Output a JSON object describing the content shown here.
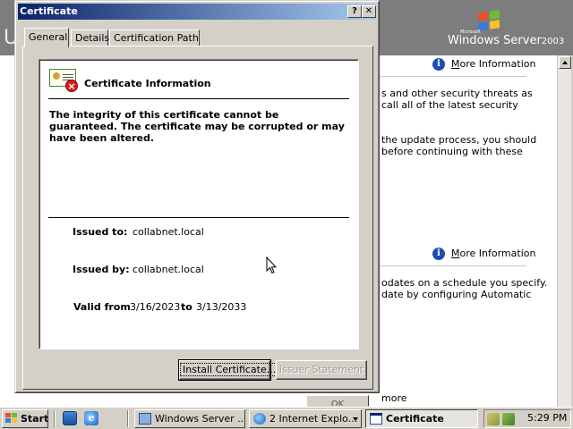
{
  "background": {
    "banner_letter": "U",
    "logo": {
      "small": "Microsoft",
      "product": "Windows Server",
      "year": "2003"
    },
    "more_info_1": "More Information",
    "more_info_2": "More Information",
    "text_lines_1": [
      "s and other security threats as",
      "call all of the latest security"
    ],
    "text_lines_2": [
      "the update process, you should",
      "before continuing with these"
    ],
    "text_lines_3": [
      "odates on a schedule you specify.",
      "date by configuring Automatic"
    ],
    "more_link": "more",
    "ok_partial": "OK"
  },
  "dialog": {
    "title": "Certificate",
    "help_btn": "?",
    "close_btn": "✕",
    "tabs": [
      "General",
      "Details",
      "Certification Path"
    ],
    "heading": "Certificate Information",
    "warning": "The integrity of this certificate cannot be guaranteed. The certificate may be corrupted or may have been altered.",
    "issued_to_label": "Issued to:",
    "issued_to_value": "collabnet.local",
    "issued_by_label": "Issued by:",
    "issued_by_value": "collabnet.local",
    "valid_from_label": "Valid from",
    "valid_from_value": "3/16/2023",
    "valid_to_label": "to",
    "valid_to_value": "3/13/2033",
    "install_btn": "Install Certificate...",
    "issuer_btn": "Issuer Statement"
  },
  "taskbar": {
    "start": "Start",
    "tasks": [
      "Windows Server ...",
      "2 Internet Explo...",
      "Certificate"
    ],
    "clock": "5:29 PM"
  }
}
